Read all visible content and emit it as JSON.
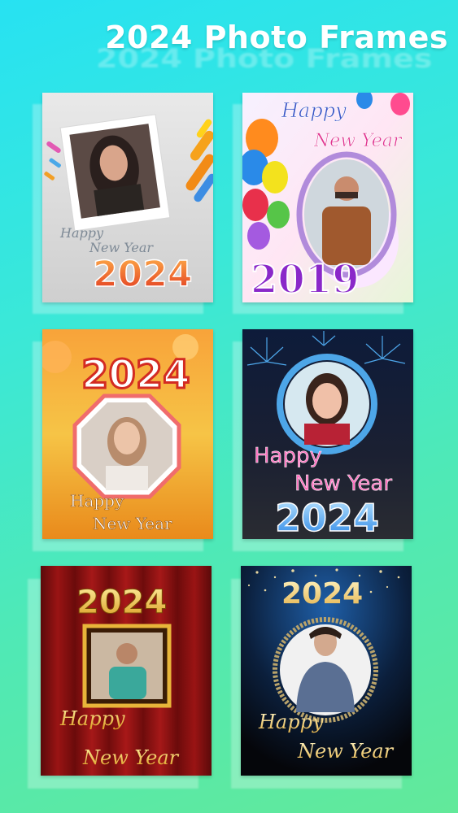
{
  "header": {
    "title": "2024 Photo Frames"
  },
  "frames": [
    {
      "line1": "Happy",
      "line2": "New Year",
      "year": "2024"
    },
    {
      "line1": "Happy",
      "line2": "New Year",
      "year": "2019"
    },
    {
      "line1": "Happy",
      "line2": "New Year",
      "year": "2024"
    },
    {
      "line1": "Happy",
      "line2": "New Year",
      "year": "2024"
    },
    {
      "line1": "Happy",
      "line2": "New Year",
      "year": "2024"
    },
    {
      "line1": "Happy",
      "line2": "New Year",
      "year": "2024"
    }
  ],
  "colors": {
    "accent_gold": "#f5c542",
    "neon_pink": "#ff4fa8",
    "neon_blue": "#4bb8ff",
    "bg_top": "#27e2f2",
    "bg_bottom": "#62e99a"
  }
}
